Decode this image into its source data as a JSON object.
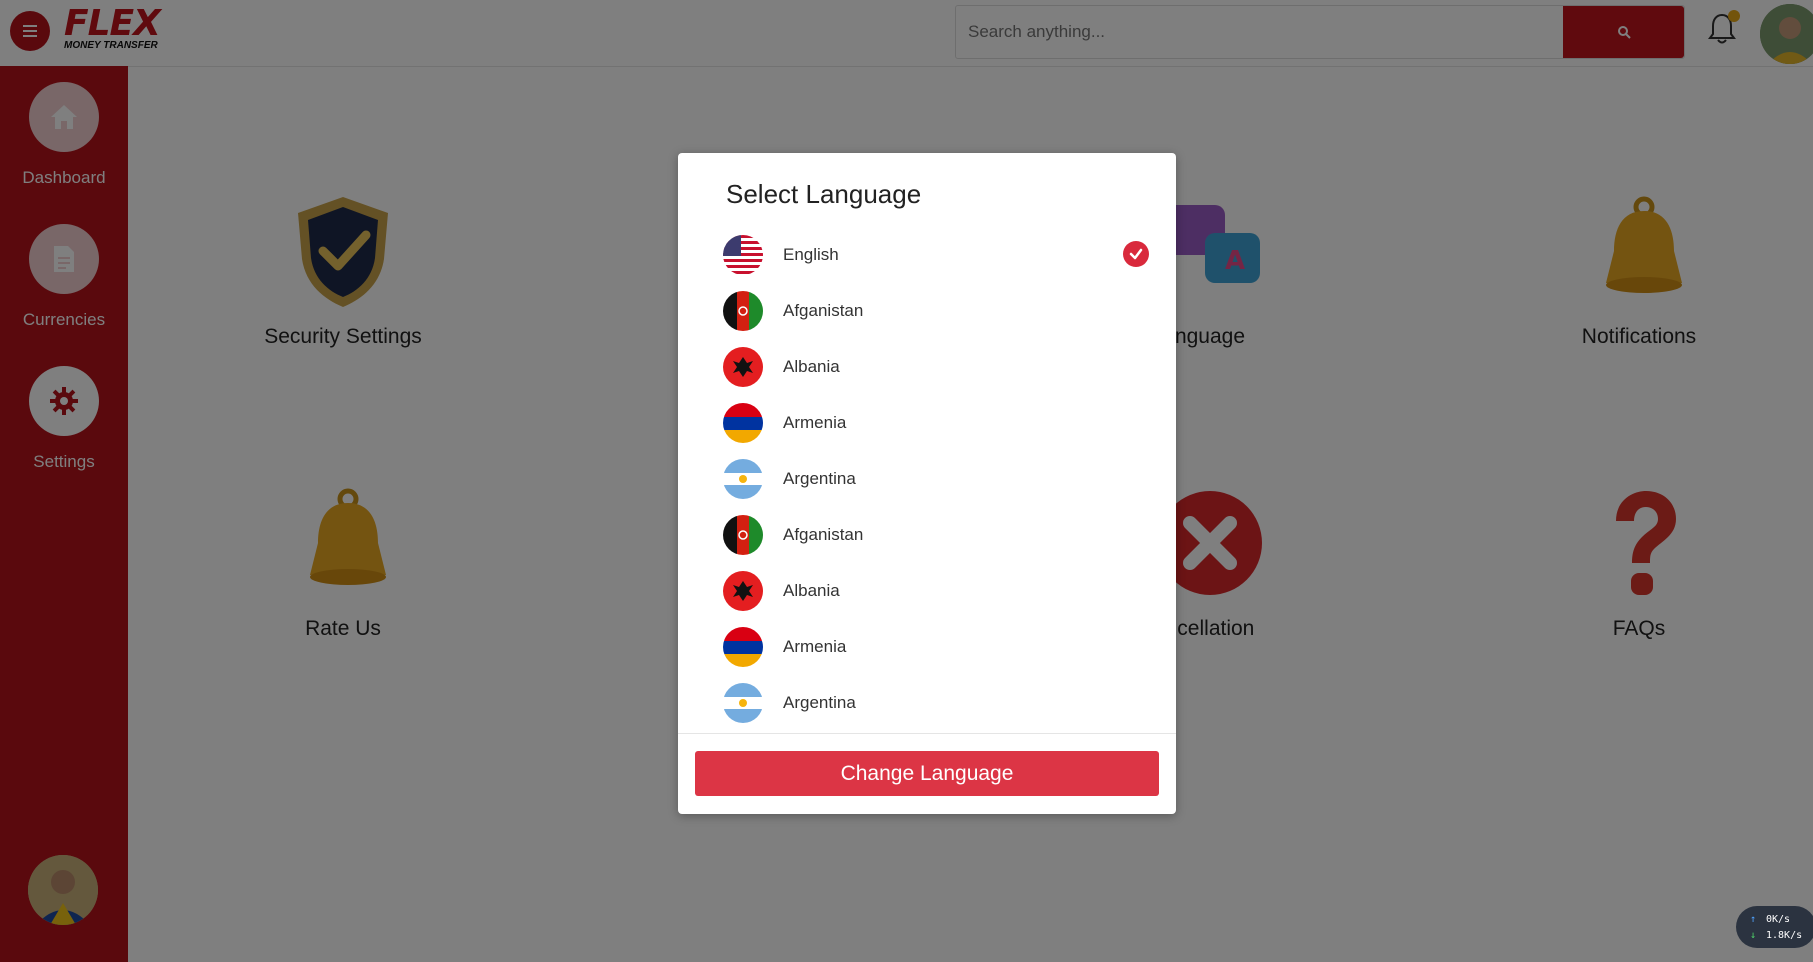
{
  "brand": {
    "name": "FLEX",
    "tagline": "MONEY TRANSFER"
  },
  "search": {
    "placeholder": "Search anything..."
  },
  "sidebar": {
    "items": [
      {
        "label": "Dashboard",
        "icon": "home-icon"
      },
      {
        "label": "Currencies",
        "icon": "document-icon"
      },
      {
        "label": "Settings",
        "icon": "gear-icon"
      }
    ]
  },
  "tiles": [
    {
      "label": "Security Settings",
      "icon": "shield-icon"
    },
    {
      "label": "nguage",
      "icon": "translate-icon"
    },
    {
      "label": "Notifications",
      "icon": "bell-icon"
    },
    {
      "label": "Rate Us",
      "icon": "bell-icon"
    },
    {
      "label": "ncellation",
      "icon": "cancel-icon"
    },
    {
      "label": "FAQs",
      "icon": "question-icon"
    }
  ],
  "modal": {
    "title": "Select Language",
    "languages": [
      {
        "name": "English",
        "flag": "us",
        "selected": true
      },
      {
        "name": "Afganistan",
        "flag": "af"
      },
      {
        "name": "Albania",
        "flag": "al"
      },
      {
        "name": "Armenia",
        "flag": "am"
      },
      {
        "name": "Argentina",
        "flag": "ar"
      },
      {
        "name": "Afganistan",
        "flag": "af"
      },
      {
        "name": "Albania",
        "flag": "al"
      },
      {
        "name": "Armenia",
        "flag": "am"
      },
      {
        "name": "Argentina",
        "flag": "ar"
      }
    ],
    "button_label": "Change Language"
  },
  "speed_widget": {
    "up": "0K/s",
    "down": "1.8K/s"
  },
  "colors": {
    "brand_red": "#b5121b",
    "button_red": "#dc3545",
    "notification_dot": "#e6a917"
  }
}
